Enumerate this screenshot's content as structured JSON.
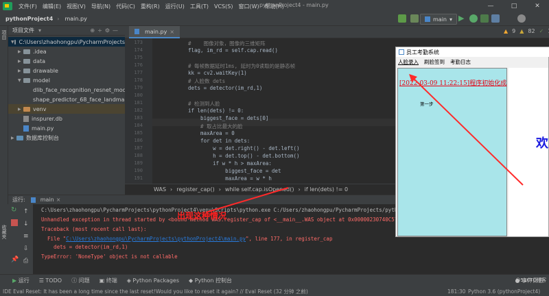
{
  "menubar": {
    "items": [
      "文件(F)",
      "编辑(E)",
      "视图(V)",
      "导航(N)",
      "代码(C)",
      "重构(R)",
      "运行(U)",
      "工具(T)",
      "VCS(S)",
      "窗口(W)",
      "帮助(H)"
    ],
    "window_title": "pythonProject4 - main.py"
  },
  "navbar": {
    "project": "pythonProject4",
    "file": "main.py",
    "run_config": "main"
  },
  "project_panel": {
    "title": "项目文件",
    "tree": [
      {
        "label": "C:\\Users\\zhaohongpu\\PycharmProjects",
        "kind": "folder"
      },
      {
        "label": ".idea",
        "kind": "folder"
      },
      {
        "label": "data",
        "kind": "folder"
      },
      {
        "label": "drawable",
        "kind": "folder"
      },
      {
        "label": "model",
        "kind": "folder"
      },
      {
        "label": "dlib_face_recognition_resnet_mod",
        "kind": "file"
      },
      {
        "label": "shape_predictor_68_face_landmar",
        "kind": "file"
      },
      {
        "label": "venv",
        "kind": "folder"
      },
      {
        "label": "inspurer.db",
        "kind": "db"
      },
      {
        "label": "main.py",
        "kind": "py"
      },
      {
        "label": "数据库控制台",
        "kind": "folder"
      }
    ]
  },
  "editor": {
    "tab": "main.py",
    "lines": [
      {
        "n": "173",
        "text": "#    图像对象，图像的三维矩阵"
      },
      {
        "n": "174",
        "text": "flag, im_rd = self.cap.read()"
      },
      {
        "n": "175",
        "text": ""
      },
      {
        "n": "176",
        "text": "# 每帧数据延时1ms, 延时为0读取的是静态帧"
      },
      {
        "n": "177",
        "text": "kk = cv2.waitKey(1)"
      },
      {
        "n": "178",
        "text": "# 人脸数 dets"
      },
      {
        "n": "179",
        "text": "dets = detector(im_rd,1)"
      },
      {
        "n": "180",
        "text": ""
      },
      {
        "n": "181",
        "text": "# 检测到人脸"
      },
      {
        "n": "182",
        "text": "if len(dets) != 0:"
      },
      {
        "n": "183",
        "text": "    biggest_face = dets[0]"
      },
      {
        "n": "184",
        "text": "    # 取占比最大的脸"
      },
      {
        "n": "185",
        "text": "    maxArea = 0"
      },
      {
        "n": "186",
        "text": "    for det in dets:"
      },
      {
        "n": "187",
        "text": "        w = det.right() - det.left()"
      },
      {
        "n": "188",
        "text": "        h = det.top() - det.bottom()"
      },
      {
        "n": "189",
        "text": "        if w * h > maxArea:"
      },
      {
        "n": "190",
        "text": "            biggest_face = det"
      },
      {
        "n": "191",
        "text": "            maxArea = w * h"
      }
    ],
    "breadcrumb": [
      "WAS",
      "register_cap()",
      "while self.cap.isOpened()",
      "if len(dets) != 0"
    ]
  },
  "run_panel": {
    "label": "运行:",
    "tab": "main",
    "console": [
      {
        "text": "C:\\Users\\zhaohongpu\\PycharmProjects\\pythonProject4\\venv\\Scripts\\python.exe C:/Users/zhaohongpu/PycharmProjects/pythonProject",
        "style": "gray"
      },
      {
        "text": "Unhandled exception in thread started by <bound method WAS.register_cap of <__main__.WAS object at 0x00000230740C5708>>",
        "style": "red"
      },
      {
        "text": "Traceback (most recent call last):",
        "style": "red"
      },
      {
        "prefix": "  File \"",
        "link": "C:\\Users\\zhaohongpu\\PycharmProjects\\pythonProject4\\main.py",
        "suffix": "\", line 177, in register_cap",
        "style": "red"
      },
      {
        "text": "    dets = detector(im_rd,1)",
        "style": "red"
      },
      {
        "text": "TypeError: 'NoneType' object is not callable",
        "style": "red"
      }
    ]
  },
  "bottom_tools": [
    "运行",
    "TODO",
    "问题",
    "终端",
    "Python Packages",
    "Python 控制台",
    "事件日志"
  ],
  "statusbar": {
    "message": "IDE Eval Reset: It has been a long time since the last reset!Would you like to reset it again? // Eval Reset (32 分钟 之前)",
    "position": "181:30",
    "interpreter": "Python 3.6 (pythonProject4)"
  },
  "app_window": {
    "title": "员工考勤系统",
    "menu": [
      "人脸录入",
      "刷脸签到",
      "考勤日志"
    ],
    "log_text": "[2022-03-09 11:22:15]程序初始化成",
    "step": "第一步",
    "big_text": "欢"
  },
  "annotation": "出现这种情况",
  "watermark": "@51CTO博客",
  "inspections": {
    "warnings": "9",
    "weak": "82",
    "typos": "13"
  },
  "colors": {
    "accent": "#4a88c7",
    "error": "#ff6b68",
    "annotation": "#ff2020"
  }
}
